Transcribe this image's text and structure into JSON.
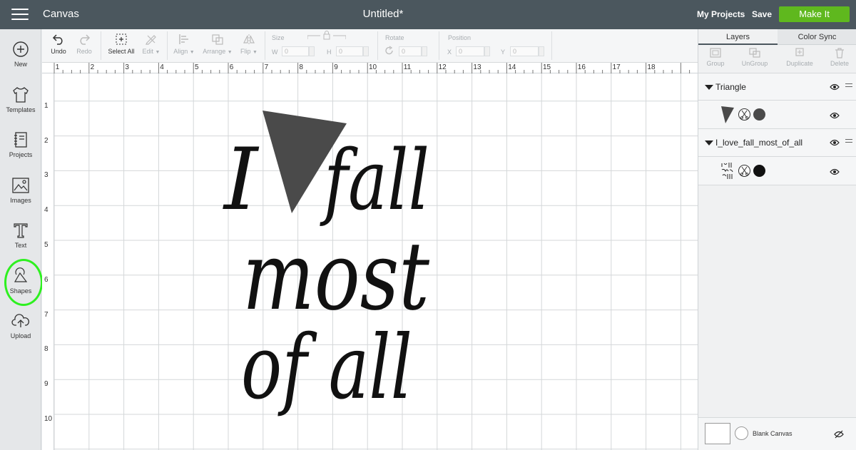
{
  "header": {
    "app_title": "Canvas",
    "doc_title": "Untitled*",
    "my_projects": "My Projects",
    "save": "Save",
    "make_it": "Make It",
    "make_it_color": "#5fb81e"
  },
  "sidebar": {
    "items": [
      {
        "label": "New",
        "icon": "plus-circle-icon"
      },
      {
        "label": "Templates",
        "icon": "tshirt-icon"
      },
      {
        "label": "Projects",
        "icon": "notebook-icon"
      },
      {
        "label": "Images",
        "icon": "image-icon"
      },
      {
        "label": "Text",
        "icon": "text-t-icon"
      },
      {
        "label": "Shapes",
        "icon": "shapes-icon"
      },
      {
        "label": "Upload",
        "icon": "cloud-upload-icon"
      }
    ],
    "highlight_color": "#2ef020"
  },
  "toolbar": {
    "undo": "Undo",
    "redo": "Redo",
    "select_all": "Select All",
    "edit": "Edit",
    "align": "Align",
    "arrange": "Arrange",
    "flip": "Flip",
    "size_label": "Size",
    "w_label": "W",
    "h_label": "H",
    "w_value": "0",
    "h_value": "0",
    "rotate_label": "Rotate",
    "rotate_value": "0",
    "position_label": "Position",
    "x_label": "X",
    "y_label": "Y",
    "x_value": "0",
    "y_value": "0"
  },
  "canvas": {
    "ruler_top": [
      "1",
      "2",
      "3",
      "4",
      "5",
      "6",
      "7",
      "8",
      "9",
      "10",
      "11",
      "12",
      "13",
      "14",
      "15",
      "16",
      "17",
      "18"
    ],
    "ruler_left": [
      "1",
      "2",
      "3",
      "4",
      "5",
      "6",
      "7",
      "8",
      "9",
      "10"
    ],
    "design_lines": [
      "I",
      "fall",
      "most",
      "of all"
    ],
    "triangle_color": "#4a4a4a",
    "text_color": "#111111"
  },
  "layers_panel": {
    "tabs": [
      "Layers",
      "Color Sync"
    ],
    "tools": [
      "Group",
      "UnGroup",
      "Duplicate",
      "Delete"
    ],
    "groups": [
      {
        "name": "Triangle",
        "layer_color": "#4a4a4a"
      },
      {
        "name": "I_love_fall_most_of_all",
        "layer_color": "#111111"
      }
    ],
    "blank_canvas": "Blank Canvas"
  }
}
